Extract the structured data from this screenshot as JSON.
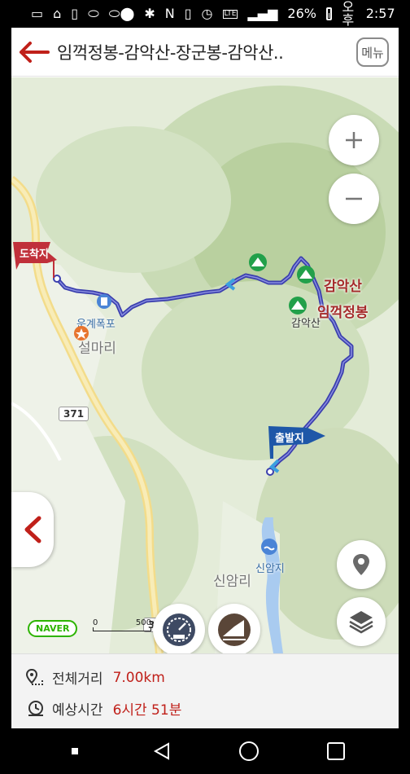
{
  "status_bar": {
    "battery": "26%",
    "ampm": "오후",
    "time": "2:57",
    "network": "LTE"
  },
  "header": {
    "title": "임꺽정봉-감악산-장군봉-감악산..",
    "menu_label": "메뉴"
  },
  "map": {
    "places": [
      "설마리",
      "신암리"
    ],
    "peaks": [
      "감악산",
      "임꺽정봉"
    ],
    "pois": [
      "운계폭포",
      "신암지",
      "감악산"
    ],
    "road_number": "371",
    "flags": {
      "end": "도착지",
      "start": "출발지"
    },
    "scale": {
      "min": "0",
      "max": "500"
    },
    "provider": "NAVER"
  },
  "info": {
    "distance_label": "전체거리",
    "distance_value": "7.00km",
    "time_label": "예상시간",
    "time_value": "6시간 51분"
  },
  "colors": {
    "accent": "#c0201a",
    "route": "#3b3fae",
    "flag": "#1e57a8",
    "end_flag": "#c0303a"
  }
}
